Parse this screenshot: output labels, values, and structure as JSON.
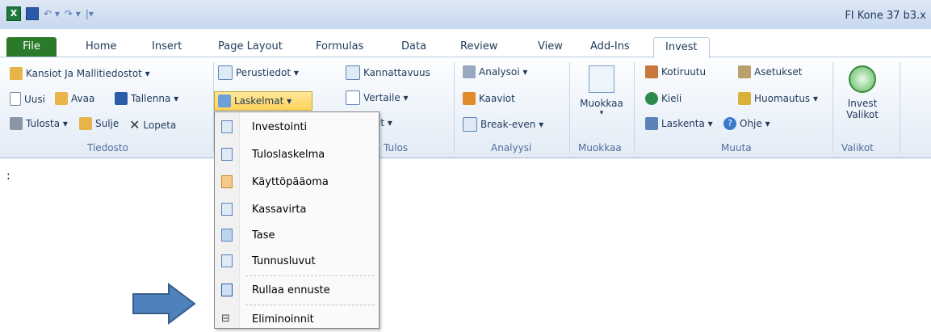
{
  "window": {
    "title": "FI Kone 37 b3.x"
  },
  "tabs": [
    "File",
    "Home",
    "Insert",
    "Page Layout",
    "Formulas",
    "Data",
    "Review",
    "View",
    "Add-Ins",
    "Invest"
  ],
  "ribbon": {
    "tiedosto": {
      "label": "Tiedosto",
      "kansiot": "Kansiot Ja Mallitiedostot ▾",
      "uusi": "Uusi",
      "avaa": "Avaa",
      "tallenna": "Tallenna ▾",
      "tulosta": "Tulosta ▾",
      "sulje": "Sulje",
      "lopeta": "Lopeta"
    },
    "laskelmat_grp": {
      "perustiedot": "Perustiedot ▾",
      "laskelmat": "Laskelmat ▾"
    },
    "tulos": {
      "label": "Tulos",
      "kannattavuus": "Kannattavuus",
      "vertaile": "Vertaile ▾",
      "raportit": "Raportit ▾"
    },
    "analyysi": {
      "label": "Analyysi",
      "analysoi": "Analysoi ▾",
      "kaaviot": "Kaaviot",
      "breakeven": "Break-even ▾"
    },
    "muokkaa": {
      "label": "Muokkaa",
      "btn": "Muokkaa"
    },
    "muuta": {
      "label": "Muuta",
      "kotiruutu": "Kotiruutu",
      "asetukset": "Asetukset",
      "kieli": "Kieli",
      "huomautus": "Huomautus ▾",
      "laskenta": "Laskenta ▾",
      "ohje": "Ohje ▾"
    },
    "valikot": {
      "label": "Valikot",
      "btn1": "Invest",
      "btn2": "Valikot"
    }
  },
  "menu": {
    "items": [
      "Investointi",
      "Tuloslaskelma",
      "Käyttöpääoma",
      "Kassavirta",
      "Tase",
      "Tunnusluvut",
      "Rullaa ennuste",
      "Eliminoinnit"
    ]
  },
  "misc": {
    "colon": ":"
  }
}
